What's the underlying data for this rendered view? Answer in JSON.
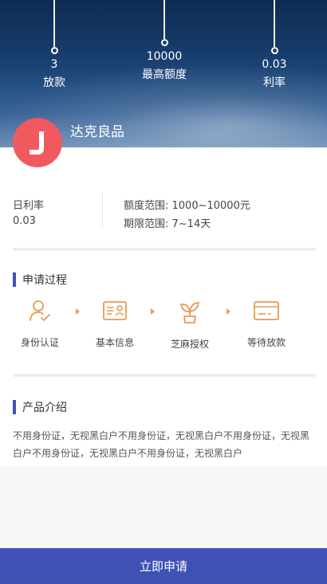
{
  "hero": {
    "stats": [
      {
        "value": "3",
        "label": "放款"
      },
      {
        "value": "10000",
        "label": "最高额度"
      },
      {
        "value": "0.03",
        "label": "利率"
      }
    ]
  },
  "product": {
    "logo_letter": "J",
    "name": "达克良品",
    "logo_color": "#f05a5f"
  },
  "rates": {
    "daily_rate_label": "日利率",
    "daily_rate_value": "0.03",
    "amount_range": "额度范围: 1000~10000元",
    "term_range": "期限范围: 7~14天"
  },
  "process": {
    "title": "申请过程",
    "steps": [
      {
        "label": "身份认证",
        "icon": "identity-check-icon"
      },
      {
        "label": "基本信息",
        "icon": "id-card-icon"
      },
      {
        "label": "芝麻授权",
        "icon": "sprout-icon"
      },
      {
        "label": "等待放款",
        "icon": "bank-card-icon"
      }
    ]
  },
  "intro": {
    "title": "产品介绍",
    "text": "不用身份证，无视黑白户不用身份证，无视黑白户不用身份证，无视黑白户不用身份证，无视黑白户不用身份证，无视黑白户"
  },
  "footer": {
    "apply_label": "立即申请",
    "accent_color": "#3f51b5",
    "icon_color": "#e59a55"
  }
}
